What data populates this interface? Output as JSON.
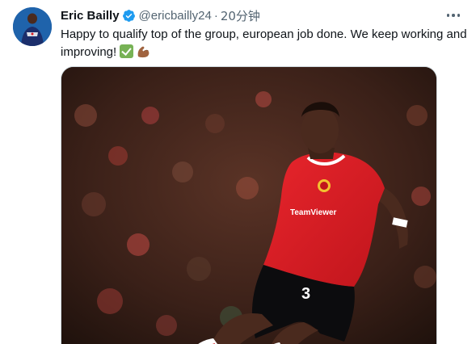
{
  "tweet": {
    "author": {
      "display_name": "Eric Bailly",
      "handle": "@ericbailly24",
      "verified": true,
      "avatar_icon": "avatar-player-photo"
    },
    "separator": "·",
    "timestamp": "20分钟",
    "text_main": "Happy to qualify top of the group, european job done. We keep working and improving!",
    "emojis": [
      "check-mark-button-emoji",
      "flexed-biceps-emoji"
    ],
    "more_icon": "more-options-icon",
    "media": {
      "description_icon": "tweet-photo",
      "jersey_number": "3",
      "sponsor_text": "TeamViewer"
    },
    "colors": {
      "verified_blue": "#1d9bf0",
      "text": "#0f1419",
      "muted": "#536471",
      "jersey_red": "#da1f26"
    }
  }
}
